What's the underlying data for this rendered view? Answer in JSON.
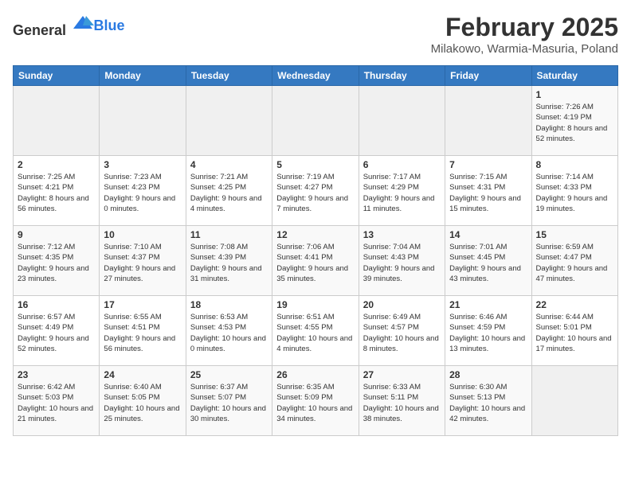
{
  "logo": {
    "text_general": "General",
    "text_blue": "Blue"
  },
  "header": {
    "month": "February 2025",
    "location": "Milakowo, Warmia-Masuria, Poland"
  },
  "weekdays": [
    "Sunday",
    "Monday",
    "Tuesday",
    "Wednesday",
    "Thursday",
    "Friday",
    "Saturday"
  ],
  "weeks": [
    [
      {
        "day": "",
        "info": ""
      },
      {
        "day": "",
        "info": ""
      },
      {
        "day": "",
        "info": ""
      },
      {
        "day": "",
        "info": ""
      },
      {
        "day": "",
        "info": ""
      },
      {
        "day": "",
        "info": ""
      },
      {
        "day": "1",
        "info": "Sunrise: 7:26 AM\nSunset: 4:19 PM\nDaylight: 8 hours and 52 minutes."
      }
    ],
    [
      {
        "day": "2",
        "info": "Sunrise: 7:25 AM\nSunset: 4:21 PM\nDaylight: 8 hours and 56 minutes."
      },
      {
        "day": "3",
        "info": "Sunrise: 7:23 AM\nSunset: 4:23 PM\nDaylight: 9 hours and 0 minutes."
      },
      {
        "day": "4",
        "info": "Sunrise: 7:21 AM\nSunset: 4:25 PM\nDaylight: 9 hours and 4 minutes."
      },
      {
        "day": "5",
        "info": "Sunrise: 7:19 AM\nSunset: 4:27 PM\nDaylight: 9 hours and 7 minutes."
      },
      {
        "day": "6",
        "info": "Sunrise: 7:17 AM\nSunset: 4:29 PM\nDaylight: 9 hours and 11 minutes."
      },
      {
        "day": "7",
        "info": "Sunrise: 7:15 AM\nSunset: 4:31 PM\nDaylight: 9 hours and 15 minutes."
      },
      {
        "day": "8",
        "info": "Sunrise: 7:14 AM\nSunset: 4:33 PM\nDaylight: 9 hours and 19 minutes."
      }
    ],
    [
      {
        "day": "9",
        "info": "Sunrise: 7:12 AM\nSunset: 4:35 PM\nDaylight: 9 hours and 23 minutes."
      },
      {
        "day": "10",
        "info": "Sunrise: 7:10 AM\nSunset: 4:37 PM\nDaylight: 9 hours and 27 minutes."
      },
      {
        "day": "11",
        "info": "Sunrise: 7:08 AM\nSunset: 4:39 PM\nDaylight: 9 hours and 31 minutes."
      },
      {
        "day": "12",
        "info": "Sunrise: 7:06 AM\nSunset: 4:41 PM\nDaylight: 9 hours and 35 minutes."
      },
      {
        "day": "13",
        "info": "Sunrise: 7:04 AM\nSunset: 4:43 PM\nDaylight: 9 hours and 39 minutes."
      },
      {
        "day": "14",
        "info": "Sunrise: 7:01 AM\nSunset: 4:45 PM\nDaylight: 9 hours and 43 minutes."
      },
      {
        "day": "15",
        "info": "Sunrise: 6:59 AM\nSunset: 4:47 PM\nDaylight: 9 hours and 47 minutes."
      }
    ],
    [
      {
        "day": "16",
        "info": "Sunrise: 6:57 AM\nSunset: 4:49 PM\nDaylight: 9 hours and 52 minutes."
      },
      {
        "day": "17",
        "info": "Sunrise: 6:55 AM\nSunset: 4:51 PM\nDaylight: 9 hours and 56 minutes."
      },
      {
        "day": "18",
        "info": "Sunrise: 6:53 AM\nSunset: 4:53 PM\nDaylight: 10 hours and 0 minutes."
      },
      {
        "day": "19",
        "info": "Sunrise: 6:51 AM\nSunset: 4:55 PM\nDaylight: 10 hours and 4 minutes."
      },
      {
        "day": "20",
        "info": "Sunrise: 6:49 AM\nSunset: 4:57 PM\nDaylight: 10 hours and 8 minutes."
      },
      {
        "day": "21",
        "info": "Sunrise: 6:46 AM\nSunset: 4:59 PM\nDaylight: 10 hours and 13 minutes."
      },
      {
        "day": "22",
        "info": "Sunrise: 6:44 AM\nSunset: 5:01 PM\nDaylight: 10 hours and 17 minutes."
      }
    ],
    [
      {
        "day": "23",
        "info": "Sunrise: 6:42 AM\nSunset: 5:03 PM\nDaylight: 10 hours and 21 minutes."
      },
      {
        "day": "24",
        "info": "Sunrise: 6:40 AM\nSunset: 5:05 PM\nDaylight: 10 hours and 25 minutes."
      },
      {
        "day": "25",
        "info": "Sunrise: 6:37 AM\nSunset: 5:07 PM\nDaylight: 10 hours and 30 minutes."
      },
      {
        "day": "26",
        "info": "Sunrise: 6:35 AM\nSunset: 5:09 PM\nDaylight: 10 hours and 34 minutes."
      },
      {
        "day": "27",
        "info": "Sunrise: 6:33 AM\nSunset: 5:11 PM\nDaylight: 10 hours and 38 minutes."
      },
      {
        "day": "28",
        "info": "Sunrise: 6:30 AM\nSunset: 5:13 PM\nDaylight: 10 hours and 42 minutes."
      },
      {
        "day": "",
        "info": ""
      }
    ]
  ]
}
